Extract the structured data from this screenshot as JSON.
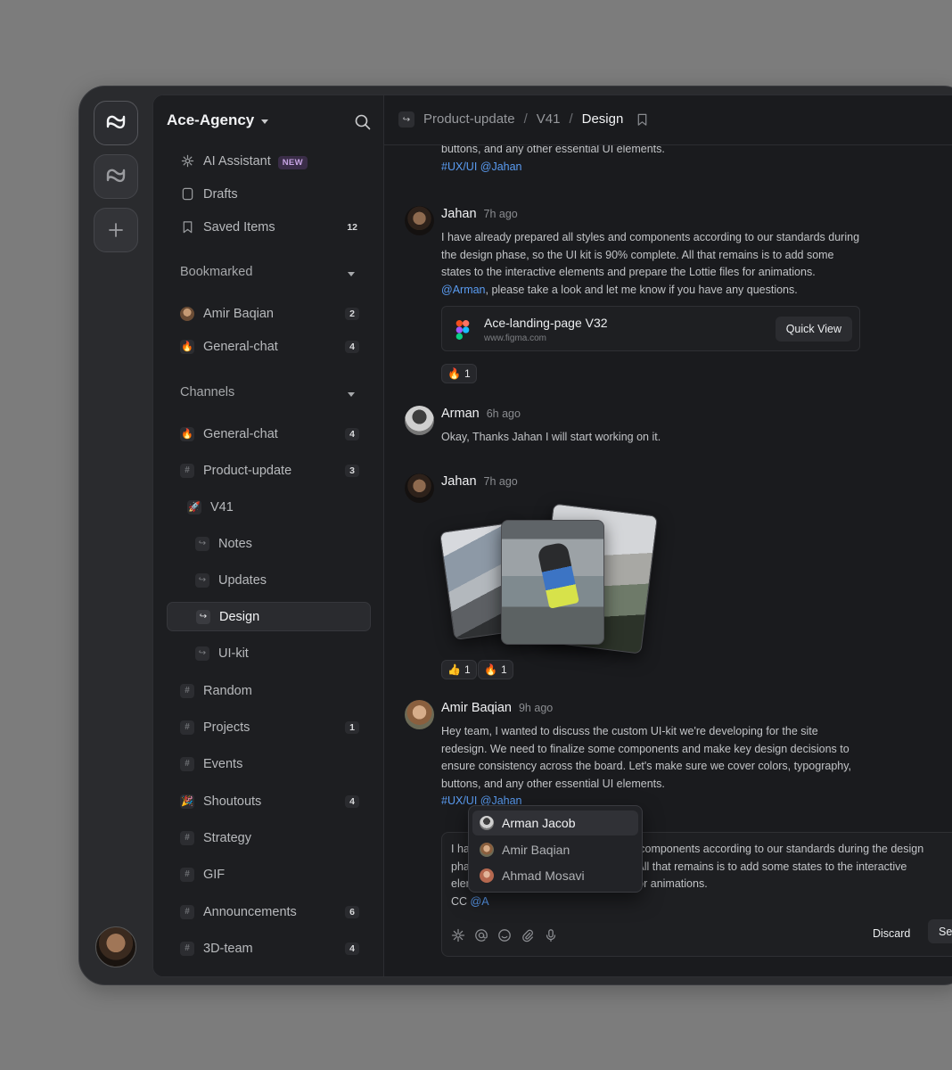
{
  "workspace": {
    "name": "Ace-Agency"
  },
  "sidebar": {
    "top_items": [
      {
        "label": "AI Assistant",
        "badge": "NEW",
        "icon": "sparkle-icon"
      },
      {
        "label": "Drafts",
        "icon": "draft-icon"
      },
      {
        "label": "Saved Items",
        "count": "12",
        "icon": "bookmark-icon"
      }
    ],
    "bookmarked": {
      "title": "Bookmarked",
      "items": [
        {
          "label": "Amir Baqian",
          "count": "2"
        },
        {
          "label": "General-chat",
          "count": "4",
          "emoji": "🔥"
        }
      ]
    },
    "channels": {
      "title": "Channels",
      "items": [
        {
          "label": "General-chat",
          "count": "4",
          "emoji": "🔥"
        },
        {
          "label": "Product-update",
          "count": "3"
        },
        {
          "label": "V41",
          "emoji": "🚀"
        },
        {
          "label": "Notes"
        },
        {
          "label": "Updates"
        },
        {
          "label": "Design"
        },
        {
          "label": "UI-kit"
        },
        {
          "label": "Random"
        },
        {
          "label": "Projects",
          "count": "1"
        },
        {
          "label": "Events"
        },
        {
          "label": "Shoutouts",
          "count": "4",
          "emoji": "🎉"
        },
        {
          "label": "Strategy"
        },
        {
          "label": "GIF"
        },
        {
          "label": "Announcements",
          "count": "6"
        },
        {
          "label": "3D-team",
          "count": "4"
        }
      ]
    }
  },
  "breadcrumb": {
    "items": [
      "Product-update",
      "V41",
      "Design"
    ]
  },
  "feed": {
    "top_fragment": {
      "text": "buttons, and any other essential UI elements.",
      "tags": "#UX/UI @Jahan"
    },
    "msg1": {
      "author": "Jahan",
      "time": "7h ago",
      "text_before": "I have already prepared all styles and components according to our standards during the design phase, so the UI kit is 90% complete. All that remains is to add some states to the interactive elements and prepare the Lottie files for animations.",
      "mention": "@Arman",
      "text_after": ", please take a look and let me know if you have any questions.",
      "attachment": {
        "title": "Ace-landing-page V32",
        "url": "www.figma.com",
        "button": "Quick View"
      },
      "reactions": [
        {
          "emoji": "🔥",
          "count": "1"
        }
      ]
    },
    "msg2": {
      "author": "Arman",
      "time": "6h ago",
      "text": "Okay, Thanks Jahan I will start working on it."
    },
    "msg3": {
      "author": "Jahan",
      "time": "7h ago",
      "reactions": [
        {
          "emoji": "👍",
          "count": "1"
        },
        {
          "emoji": "🔥",
          "count": "1"
        }
      ]
    },
    "msg4": {
      "author": "Amir Baqian",
      "time": "9h ago",
      "text": "Hey team, I wanted to discuss the custom UI-kit we're developing for the site redesign. We need to finalize some components and make key design decisions to ensure consistency across the board. Let's make sure we cover colors, typography, buttons, and any other essential UI elements.",
      "tags": "#UX/UI @Jahan"
    }
  },
  "composer": {
    "text_line1": "I have already prepared all styles and components according to our standards during the design",
    "text_line2": "phase, so the UI kit is 90% complete. All that remains is to add some states to the interactive",
    "text_line3": "elements and prepare the Lottie files for animations.",
    "cc_label": "CC",
    "cc_mention": "@A",
    "discard_label": "Discard",
    "send_label": "Send"
  },
  "mention_popup": {
    "items": [
      "Arman Jacob",
      "Amir Baqian",
      "Ahmad Mosavi"
    ],
    "selected": "Arman Jacob"
  },
  "colors": {
    "accent_link": "#5a9cf2",
    "bg": "#1a1b1e",
    "sidebar_bg": "#1d1e21"
  }
}
